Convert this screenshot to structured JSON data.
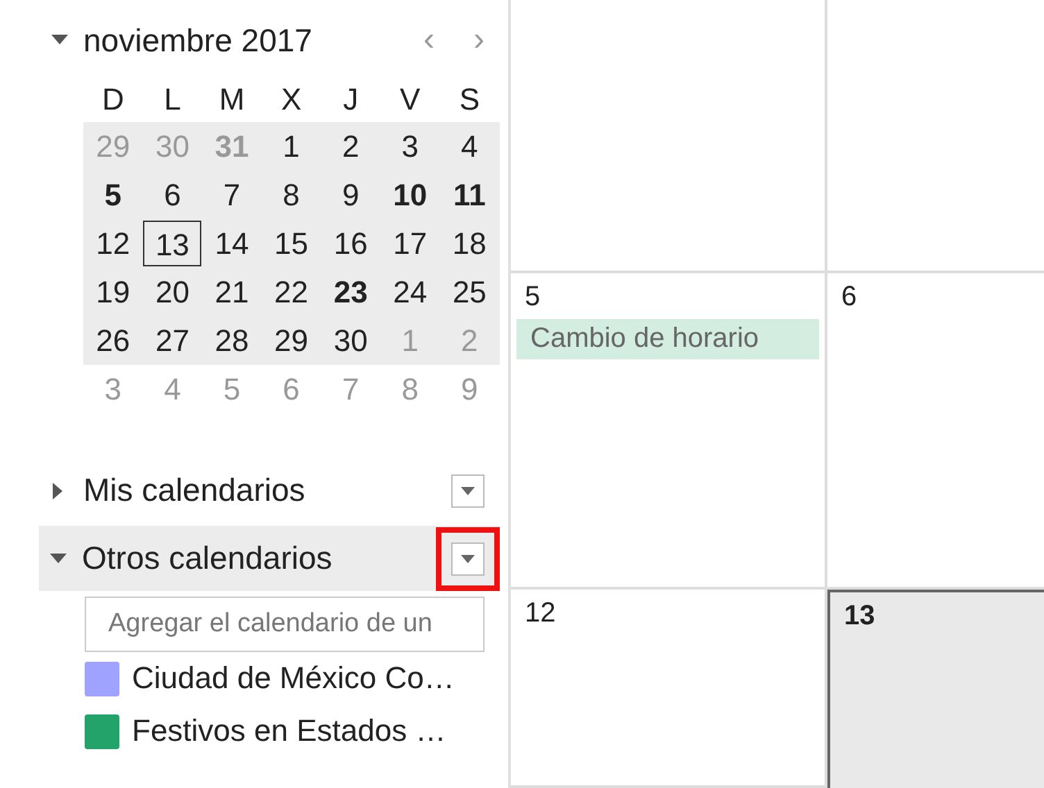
{
  "mini_calendar": {
    "title": "noviembre 2017",
    "expanded": true,
    "prev": "‹",
    "next": "›",
    "weekdays": [
      "D",
      "L",
      "M",
      "X",
      "J",
      "V",
      "S"
    ],
    "weeks": [
      {
        "shaded": true,
        "days": [
          {
            "n": "29",
            "other_month": true,
            "bold": false,
            "selected": false
          },
          {
            "n": "30",
            "other_month": true,
            "bold": false,
            "selected": false
          },
          {
            "n": "31",
            "other_month": true,
            "bold": true,
            "selected": false
          },
          {
            "n": "1",
            "other_month": false,
            "bold": false,
            "selected": false
          },
          {
            "n": "2",
            "other_month": false,
            "bold": false,
            "selected": false
          },
          {
            "n": "3",
            "other_month": false,
            "bold": false,
            "selected": false
          },
          {
            "n": "4",
            "other_month": false,
            "bold": false,
            "selected": false
          }
        ]
      },
      {
        "shaded": true,
        "days": [
          {
            "n": "5",
            "other_month": false,
            "bold": true,
            "selected": false
          },
          {
            "n": "6",
            "other_month": false,
            "bold": false,
            "selected": false
          },
          {
            "n": "7",
            "other_month": false,
            "bold": false,
            "selected": false
          },
          {
            "n": "8",
            "other_month": false,
            "bold": false,
            "selected": false
          },
          {
            "n": "9",
            "other_month": false,
            "bold": false,
            "selected": false
          },
          {
            "n": "10",
            "other_month": false,
            "bold": true,
            "selected": false
          },
          {
            "n": "11",
            "other_month": false,
            "bold": true,
            "selected": false
          }
        ]
      },
      {
        "shaded": true,
        "days": [
          {
            "n": "12",
            "other_month": false,
            "bold": false,
            "selected": false
          },
          {
            "n": "13",
            "other_month": false,
            "bold": false,
            "selected": true
          },
          {
            "n": "14",
            "other_month": false,
            "bold": false,
            "selected": false
          },
          {
            "n": "15",
            "other_month": false,
            "bold": false,
            "selected": false
          },
          {
            "n": "16",
            "other_month": false,
            "bold": false,
            "selected": false
          },
          {
            "n": "17",
            "other_month": false,
            "bold": false,
            "selected": false
          },
          {
            "n": "18",
            "other_month": false,
            "bold": false,
            "selected": false
          }
        ]
      },
      {
        "shaded": true,
        "days": [
          {
            "n": "19",
            "other_month": false,
            "bold": false,
            "selected": false
          },
          {
            "n": "20",
            "other_month": false,
            "bold": false,
            "selected": false
          },
          {
            "n": "21",
            "other_month": false,
            "bold": false,
            "selected": false
          },
          {
            "n": "22",
            "other_month": false,
            "bold": false,
            "selected": false
          },
          {
            "n": "23",
            "other_month": false,
            "bold": true,
            "selected": false
          },
          {
            "n": "24",
            "other_month": false,
            "bold": false,
            "selected": false
          },
          {
            "n": "25",
            "other_month": false,
            "bold": false,
            "selected": false
          }
        ]
      },
      {
        "shaded": true,
        "days": [
          {
            "n": "26",
            "other_month": false,
            "bold": false,
            "selected": false
          },
          {
            "n": "27",
            "other_month": false,
            "bold": false,
            "selected": false
          },
          {
            "n": "28",
            "other_month": false,
            "bold": false,
            "selected": false
          },
          {
            "n": "29",
            "other_month": false,
            "bold": false,
            "selected": false
          },
          {
            "n": "30",
            "other_month": false,
            "bold": false,
            "selected": false
          },
          {
            "n": "1",
            "other_month": true,
            "bold": false,
            "selected": false
          },
          {
            "n": "2",
            "other_month": true,
            "bold": false,
            "selected": false
          }
        ]
      },
      {
        "shaded": false,
        "days": [
          {
            "n": "3",
            "other_month": true,
            "bold": false,
            "selected": false
          },
          {
            "n": "4",
            "other_month": true,
            "bold": false,
            "selected": false
          },
          {
            "n": "5",
            "other_month": true,
            "bold": false,
            "selected": false
          },
          {
            "n": "6",
            "other_month": true,
            "bold": false,
            "selected": false
          },
          {
            "n": "7",
            "other_month": true,
            "bold": false,
            "selected": false
          },
          {
            "n": "8",
            "other_month": true,
            "bold": false,
            "selected": false
          },
          {
            "n": "9",
            "other_month": true,
            "bold": false,
            "selected": false
          }
        ]
      }
    ]
  },
  "sections": [
    {
      "title": "Mis calendarios",
      "expanded": false,
      "selected": false,
      "annotated": false
    },
    {
      "title": "Otros calendarios",
      "expanded": true,
      "selected": true,
      "annotated": true,
      "placeholder": "Agregar el calendario de un",
      "calendars": [
        {
          "name": "Ciudad de México Co…",
          "color": "#9fa3ff"
        },
        {
          "name": "Festivos en Estados …",
          "color": "#23a369"
        }
      ]
    }
  ],
  "month_grid": {
    "weeks": [
      {
        "cells": [
          {
            "today": false
          },
          {
            "today": false
          }
        ]
      },
      {
        "cells": [
          {
            "day": "5",
            "today": false,
            "events": [
              {
                "title": "Cambio de horario",
                "color": "#d4ede1"
              }
            ]
          },
          {
            "day": "6",
            "today": false
          }
        ]
      },
      {
        "cells": [
          {
            "day": "12",
            "today": false
          },
          {
            "day": "13",
            "today": true
          }
        ]
      }
    ]
  }
}
